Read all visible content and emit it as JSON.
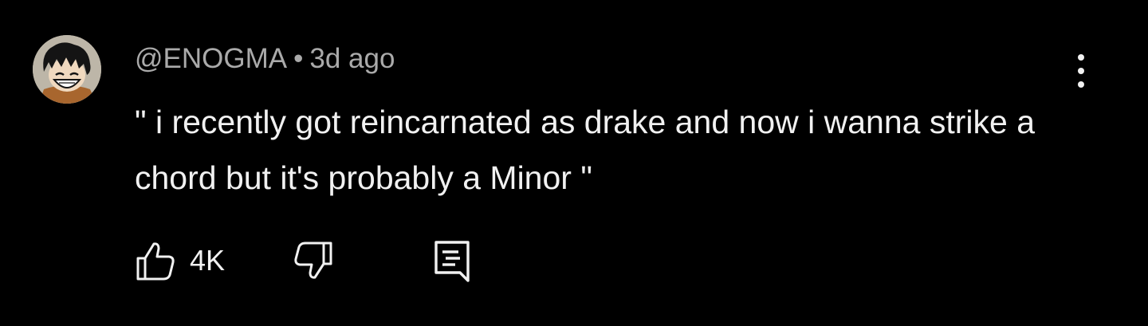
{
  "comment": {
    "author": "@ENOGMA",
    "separator": "•",
    "timestamp": "3d ago",
    "text": "\" i recently got reincarnated as drake and now i wanna strike a chord but it's probably a Minor \"",
    "like_count": "4K"
  },
  "icons": {
    "avatar": "anime-avatar",
    "menu": "more-vert-icon",
    "like": "thumbs-up-icon",
    "dislike": "thumbs-down-icon",
    "reply": "reply-comment-icon"
  },
  "colors": {
    "background": "#000000",
    "primary_text": "#f1f1f1",
    "secondary_text": "#aaaaaa"
  }
}
